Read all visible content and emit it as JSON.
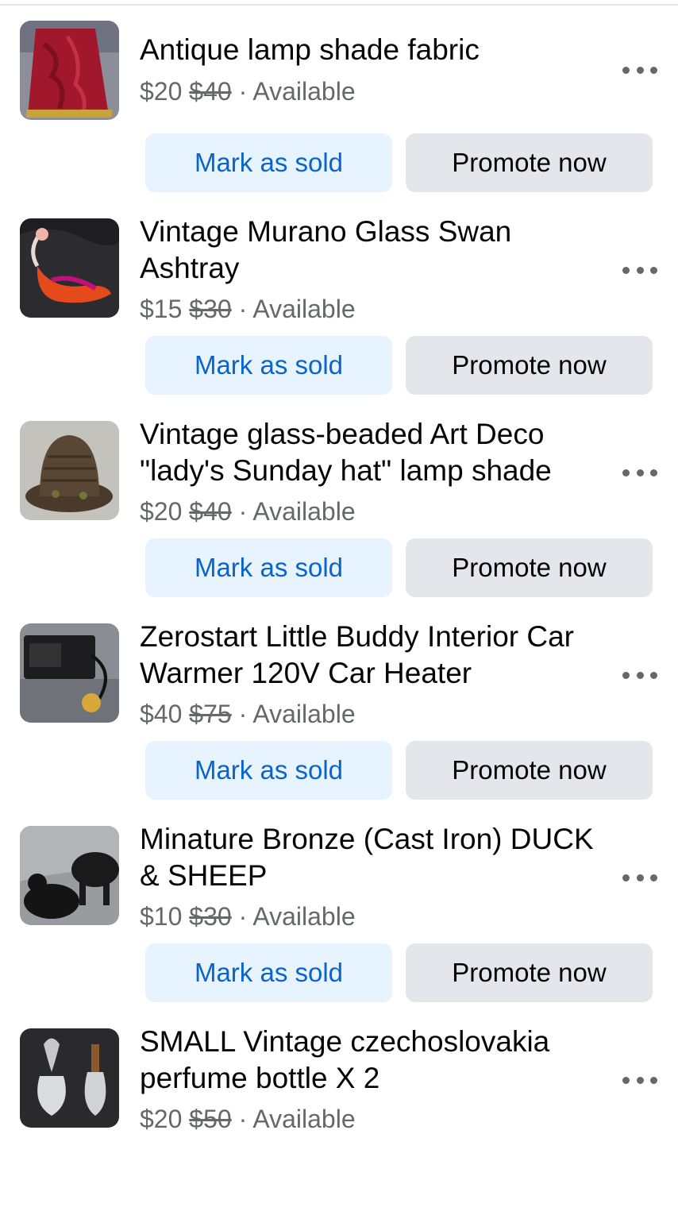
{
  "listings": [
    {
      "title": "Antique lamp shade fabric",
      "price": "$20",
      "original_price": "$40",
      "separator": " · ",
      "status": "Available",
      "image": "red-lamp-shade"
    },
    {
      "title": "Vintage Murano Glass Swan Ashtray",
      "price": "$15",
      "original_price": "$30",
      "separator": " · ",
      "status": "Available",
      "image": "glass-swan"
    },
    {
      "title": "Vintage glass-beaded Art Deco \"lady's Sunday hat\" lamp shade",
      "price": "$20",
      "original_price": "$40",
      "separator": " · ",
      "status": "Available",
      "image": "beaded-hat-shade"
    },
    {
      "title": "Zerostart Little Buddy Interior Car Warmer 120V Car Heater",
      "price": "$40",
      "original_price": "$75",
      "separator": " · ",
      "status": "Available",
      "image": "car-heater"
    },
    {
      "title": "Minature Bronze (Cast Iron) DUCK & SHEEP",
      "price": "$10",
      "original_price": "$30",
      "separator": " · ",
      "status": "Available",
      "image": "cast-iron-figures"
    },
    {
      "title": "SMALL Vintage czechoslovakia perfume bottle X 2",
      "price": "$20",
      "original_price": "$50",
      "separator": " · ",
      "status": "Available",
      "image": "perfume-bottles"
    }
  ],
  "actions": {
    "mark_sold_label": "Mark as sold",
    "promote_label": "Promote now"
  },
  "colors": {
    "mark_sold_bg": "#e7f3ff",
    "mark_sold_text": "#0a64c9",
    "promote_bg": "#e4e6eb",
    "secondary_text": "#65676b"
  }
}
